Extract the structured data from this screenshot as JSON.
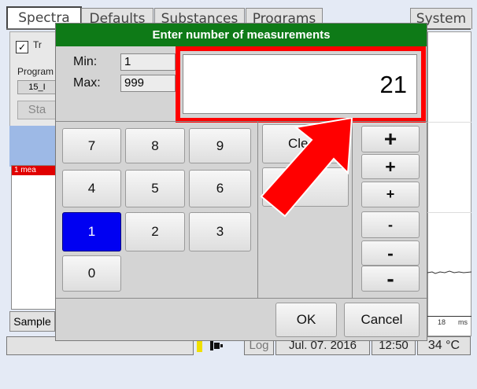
{
  "tabs": [
    "Spectra",
    "Defaults",
    "Substances",
    "Programs",
    "System"
  ],
  "background": {
    "checkbox_label": "Tr",
    "program_label": "Program",
    "program_value": "15_I",
    "start_label": "Sta",
    "list_row": "1   mea",
    "sample_button": "Sample",
    "axis_tick": "18",
    "axis_unit": "ms"
  },
  "dialog": {
    "title": "Enter number of measurements",
    "min_label": "Min:",
    "min_value": "1",
    "max_label": "Max:",
    "max_value": "999",
    "current_value": "21",
    "keypad": [
      "7",
      "8",
      "9",
      "4",
      "5",
      "6",
      "1",
      "2",
      "3",
      "0"
    ],
    "selected_key": "1",
    "clear_label": "Clea",
    "plus_labels": [
      "+",
      "+",
      "+"
    ],
    "minus_labels": [
      "-",
      "-",
      "-"
    ],
    "ok_label": "OK",
    "cancel_label": "Cancel"
  },
  "status": {
    "log_label": "Log",
    "date": "Jul. 07. 2016",
    "time": "12:50",
    "temperature": "34 °C"
  },
  "colors": {
    "titlebar": "#0e7a17",
    "selected_key": "#0000f2",
    "highlight": "#ff0000"
  }
}
